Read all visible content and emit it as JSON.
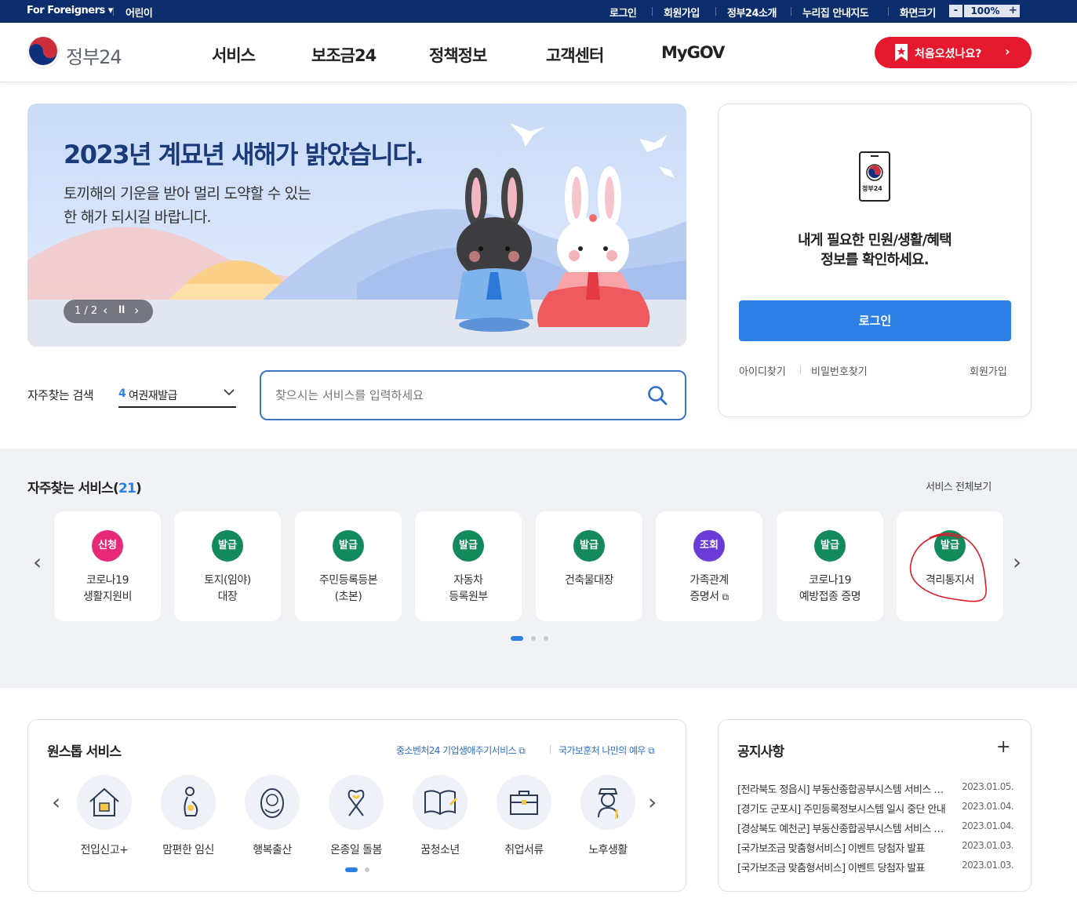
{
  "utility_bar": {
    "for_foreigners": "For Foreigners",
    "kids": "어린이",
    "login": "로그인",
    "signup": "회원가입",
    "about": "정부24소개",
    "nuri": "누리집 안내지도",
    "screen_size": "화면크기",
    "zoom_minus": "-",
    "zoom_value": "100%",
    "zoom_plus": "+"
  },
  "header": {
    "logo_text": "정부24",
    "nav": [
      "서비스",
      "보조금24",
      "정책정보",
      "고객센터",
      "MyGOV"
    ],
    "first_visit": "처음오셨나요?"
  },
  "banner": {
    "title": "2023년 계묘년 새해가 밝았습니다.",
    "line1": "토끼해의 기운을 받아 멀리 도약할 수 있는",
    "line2": "한 해가 되시길 바랍니다.",
    "pager": "1 / 2"
  },
  "login_card": {
    "phone_label": "정부24",
    "message_line1": "내게 필요한 민원/생활/혜택",
    "message_line2": "정보를 확인하세요.",
    "login_button": "로그인",
    "find_id": "아이디찾기",
    "find_pw": "비밀번호찾기",
    "signup": "회원가입"
  },
  "search": {
    "label": "자주찾는 검색",
    "rank": "4",
    "keyword": "여권재발급",
    "placeholder": "찾으시는 서비스를 입력하세요"
  },
  "services": {
    "title": "자주찾는 서비스(",
    "count": "21",
    "title_end": ")",
    "view_all": "서비스 전체보기",
    "cards": [
      {
        "badge": "신청",
        "color": "#e8297a",
        "line1": "코로나19",
        "line2": "생활지원비"
      },
      {
        "badge": "발급",
        "color": "#128a5c",
        "line1": "토지(임야)",
        "line2": "대장"
      },
      {
        "badge": "발급",
        "color": "#128a5c",
        "line1": "주민등록등본",
        "line2": "(초본)"
      },
      {
        "badge": "발급",
        "color": "#128a5c",
        "line1": "자동차",
        "line2": "등록원부"
      },
      {
        "badge": "발급",
        "color": "#128a5c",
        "line1": "건축물대장",
        "line2": ""
      },
      {
        "badge": "조회",
        "color": "#6a3bd6",
        "line1": "가족관계",
        "line2": "증명서"
      },
      {
        "badge": "발급",
        "color": "#128a5c",
        "line1": "코로나19",
        "line2": "예방접종 증명"
      },
      {
        "badge": "발급",
        "color": "#128a5c",
        "line1": "격리통지서",
        "line2": ""
      }
    ]
  },
  "onestop": {
    "title": "원스톱 서비스",
    "link1": "중소벤처24 기업생애주기서비스",
    "link2": "국가보훈처 나만의 예우",
    "items": [
      {
        "label": "전입신고+",
        "icon": "house-icon"
      },
      {
        "label": "맘편한 임신",
        "icon": "pregnant-icon"
      },
      {
        "label": "행복출산",
        "icon": "baby-icon"
      },
      {
        "label": "온종일 돌봄",
        "icon": "ribbon-heart-icon"
      },
      {
        "label": "꿈청소년",
        "icon": "book-icon"
      },
      {
        "label": "취업서류",
        "icon": "briefcase-icon"
      },
      {
        "label": "노후생활",
        "icon": "elder-icon"
      }
    ]
  },
  "notice": {
    "title": "공지사항",
    "more": "+",
    "items": [
      {
        "text": "[전라북도 정읍시] 부동산종합공부시스템 서비스 일시 중단 안내",
        "date": "2023.01.05."
      },
      {
        "text": "[경기도 군포시] 주민등록정보시스템 일시 중단 안내",
        "date": "2023.01.04."
      },
      {
        "text": "[경상북도 예천군] 부동산종합공부시스템 서비스 일시 중단 안내",
        "date": "2023.01.04."
      },
      {
        "text": "[국가보조금 맞춤형서비스] 이벤트 당첨자 발표",
        "date": "2023.01.03."
      },
      {
        "text": "[국가보조금 맞춤형서비스] 이벤트 당첨자 발표",
        "date": "2023.01.03."
      }
    ]
  },
  "colors": {
    "navy": "#0c2d6b",
    "primary_blue": "#2d7fe6",
    "red": "#e4192d",
    "issue_green": "#128a5c",
    "apply_pink": "#e8297a",
    "lookup_purple": "#6a3bd6"
  }
}
